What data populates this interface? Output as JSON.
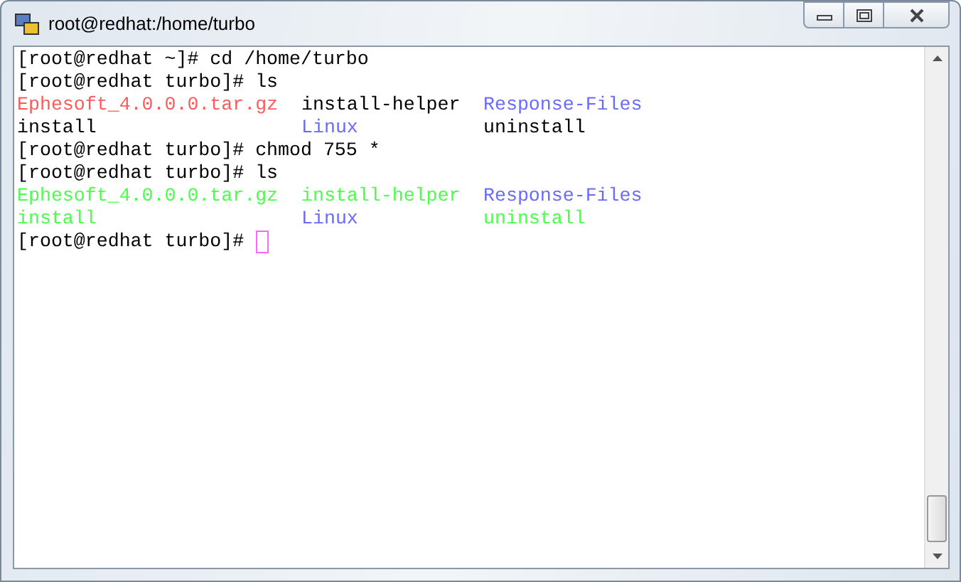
{
  "window": {
    "title": "root@redhat:/home/turbo"
  },
  "lines": [
    {
      "kind": "command",
      "text": "[root@redhat ~]# cd /home/turbo"
    },
    {
      "kind": "command",
      "text": "[root@redhat turbo]# ls"
    },
    {
      "kind": "listing",
      "entries": [
        {
          "text": "Ephesoft_4.0.0.0.tar.gz",
          "color": "#ff5a5a"
        },
        {
          "text": "install-helper",
          "color": "#000000"
        },
        {
          "text": "Response-Files",
          "color": "#6a6aff"
        }
      ]
    },
    {
      "kind": "listing",
      "entries": [
        {
          "text": "install",
          "color": "#000000"
        },
        {
          "text": "Linux",
          "color": "#6a6aff"
        },
        {
          "text": "uninstall",
          "color": "#000000"
        }
      ]
    },
    {
      "kind": "command",
      "text": "[root@redhat turbo]# chmod 755 *"
    },
    {
      "kind": "command",
      "text": "[root@redhat turbo]# ls"
    },
    {
      "kind": "listing",
      "entries": [
        {
          "text": "Ephesoft_4.0.0.0.tar.gz",
          "color": "#4aff4a"
        },
        {
          "text": "install-helper",
          "color": "#4aff4a"
        },
        {
          "text": "Response-Files",
          "color": "#6a6aff"
        }
      ]
    },
    {
      "kind": "listing",
      "entries": [
        {
          "text": "install",
          "color": "#4aff4a"
        },
        {
          "text": "Linux",
          "color": "#6a6aff"
        },
        {
          "text": "uninstall",
          "color": "#4aff4a"
        }
      ]
    },
    {
      "kind": "prompt",
      "text": "[root@redhat turbo]#"
    }
  ]
}
